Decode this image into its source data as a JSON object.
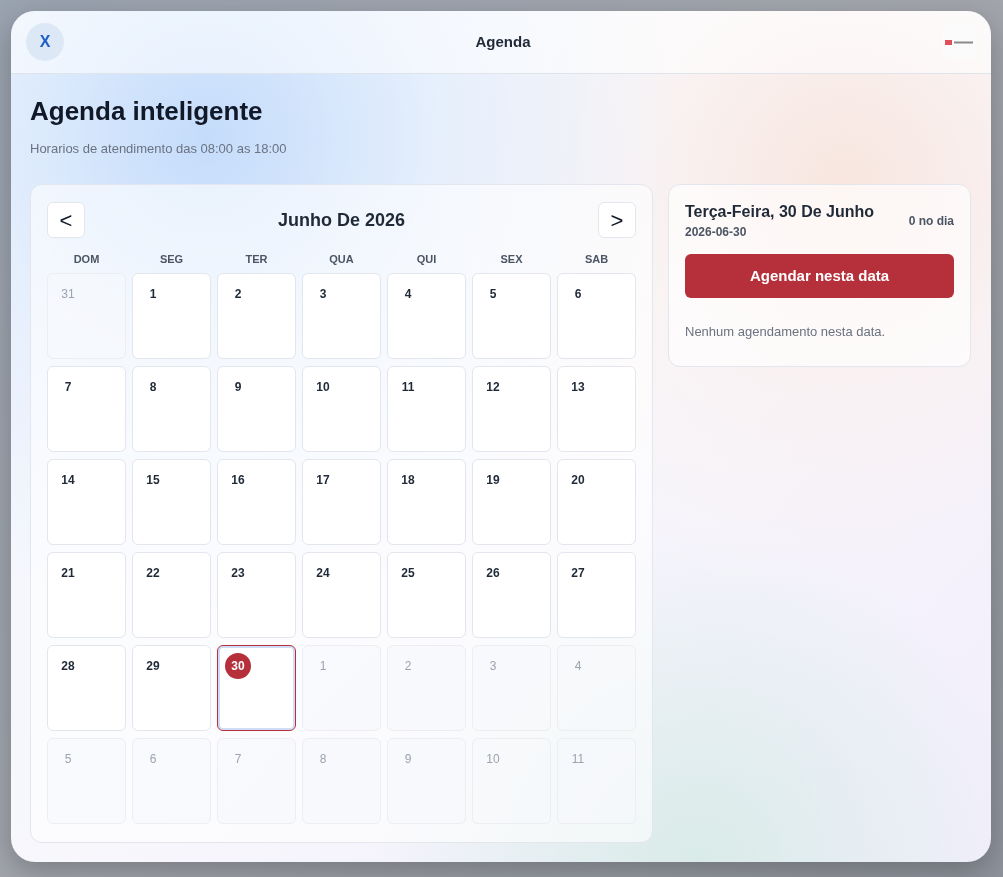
{
  "window": {
    "close_label": "X",
    "title": "Agenda"
  },
  "header": {
    "title": "Agenda inteligente",
    "subtitle": "Horarios de atendimento das 08:00 as 18:00"
  },
  "calendar": {
    "prev_label": "<",
    "title": "Junho De 2026",
    "next_label": ">",
    "weekdays": [
      "DOM",
      "SEG",
      "TER",
      "QUA",
      "QUI",
      "SEX",
      "SAB"
    ],
    "days": [
      {
        "label": "31",
        "in_month": false,
        "selected": false
      },
      {
        "label": "1",
        "in_month": true,
        "selected": false
      },
      {
        "label": "2",
        "in_month": true,
        "selected": false
      },
      {
        "label": "3",
        "in_month": true,
        "selected": false
      },
      {
        "label": "4",
        "in_month": true,
        "selected": false
      },
      {
        "label": "5",
        "in_month": true,
        "selected": false
      },
      {
        "label": "6",
        "in_month": true,
        "selected": false
      },
      {
        "label": "7",
        "in_month": true,
        "selected": false
      },
      {
        "label": "8",
        "in_month": true,
        "selected": false
      },
      {
        "label": "9",
        "in_month": true,
        "selected": false
      },
      {
        "label": "10",
        "in_month": true,
        "selected": false
      },
      {
        "label": "11",
        "in_month": true,
        "selected": false
      },
      {
        "label": "12",
        "in_month": true,
        "selected": false
      },
      {
        "label": "13",
        "in_month": true,
        "selected": false
      },
      {
        "label": "14",
        "in_month": true,
        "selected": false
      },
      {
        "label": "15",
        "in_month": true,
        "selected": false
      },
      {
        "label": "16",
        "in_month": true,
        "selected": false
      },
      {
        "label": "17",
        "in_month": true,
        "selected": false
      },
      {
        "label": "18",
        "in_month": true,
        "selected": false
      },
      {
        "label": "19",
        "in_month": true,
        "selected": false
      },
      {
        "label": "20",
        "in_month": true,
        "selected": false
      },
      {
        "label": "21",
        "in_month": true,
        "selected": false
      },
      {
        "label": "22",
        "in_month": true,
        "selected": false
      },
      {
        "label": "23",
        "in_month": true,
        "selected": false
      },
      {
        "label": "24",
        "in_month": true,
        "selected": false
      },
      {
        "label": "25",
        "in_month": true,
        "selected": false
      },
      {
        "label": "26",
        "in_month": true,
        "selected": false
      },
      {
        "label": "27",
        "in_month": true,
        "selected": false
      },
      {
        "label": "28",
        "in_month": true,
        "selected": false
      },
      {
        "label": "29",
        "in_month": true,
        "selected": false
      },
      {
        "label": "30",
        "in_month": true,
        "selected": true
      },
      {
        "label": "1",
        "in_month": false,
        "selected": false
      },
      {
        "label": "2",
        "in_month": false,
        "selected": false
      },
      {
        "label": "3",
        "in_month": false,
        "selected": false
      },
      {
        "label": "4",
        "in_month": false,
        "selected": false
      },
      {
        "label": "5",
        "in_month": false,
        "selected": false
      },
      {
        "label": "6",
        "in_month": false,
        "selected": false
      },
      {
        "label": "7",
        "in_month": false,
        "selected": false
      },
      {
        "label": "8",
        "in_month": false,
        "selected": false
      },
      {
        "label": "9",
        "in_month": false,
        "selected": false
      },
      {
        "label": "10",
        "in_month": false,
        "selected": false
      },
      {
        "label": "11",
        "in_month": false,
        "selected": false
      }
    ]
  },
  "details": {
    "title": "Terça-Feira, 30 De Junho",
    "date": "2026-06-30",
    "count": "0 no dia",
    "button": "Agendar nesta data",
    "empty_message": "Nenhum agendamento nesta data."
  }
}
